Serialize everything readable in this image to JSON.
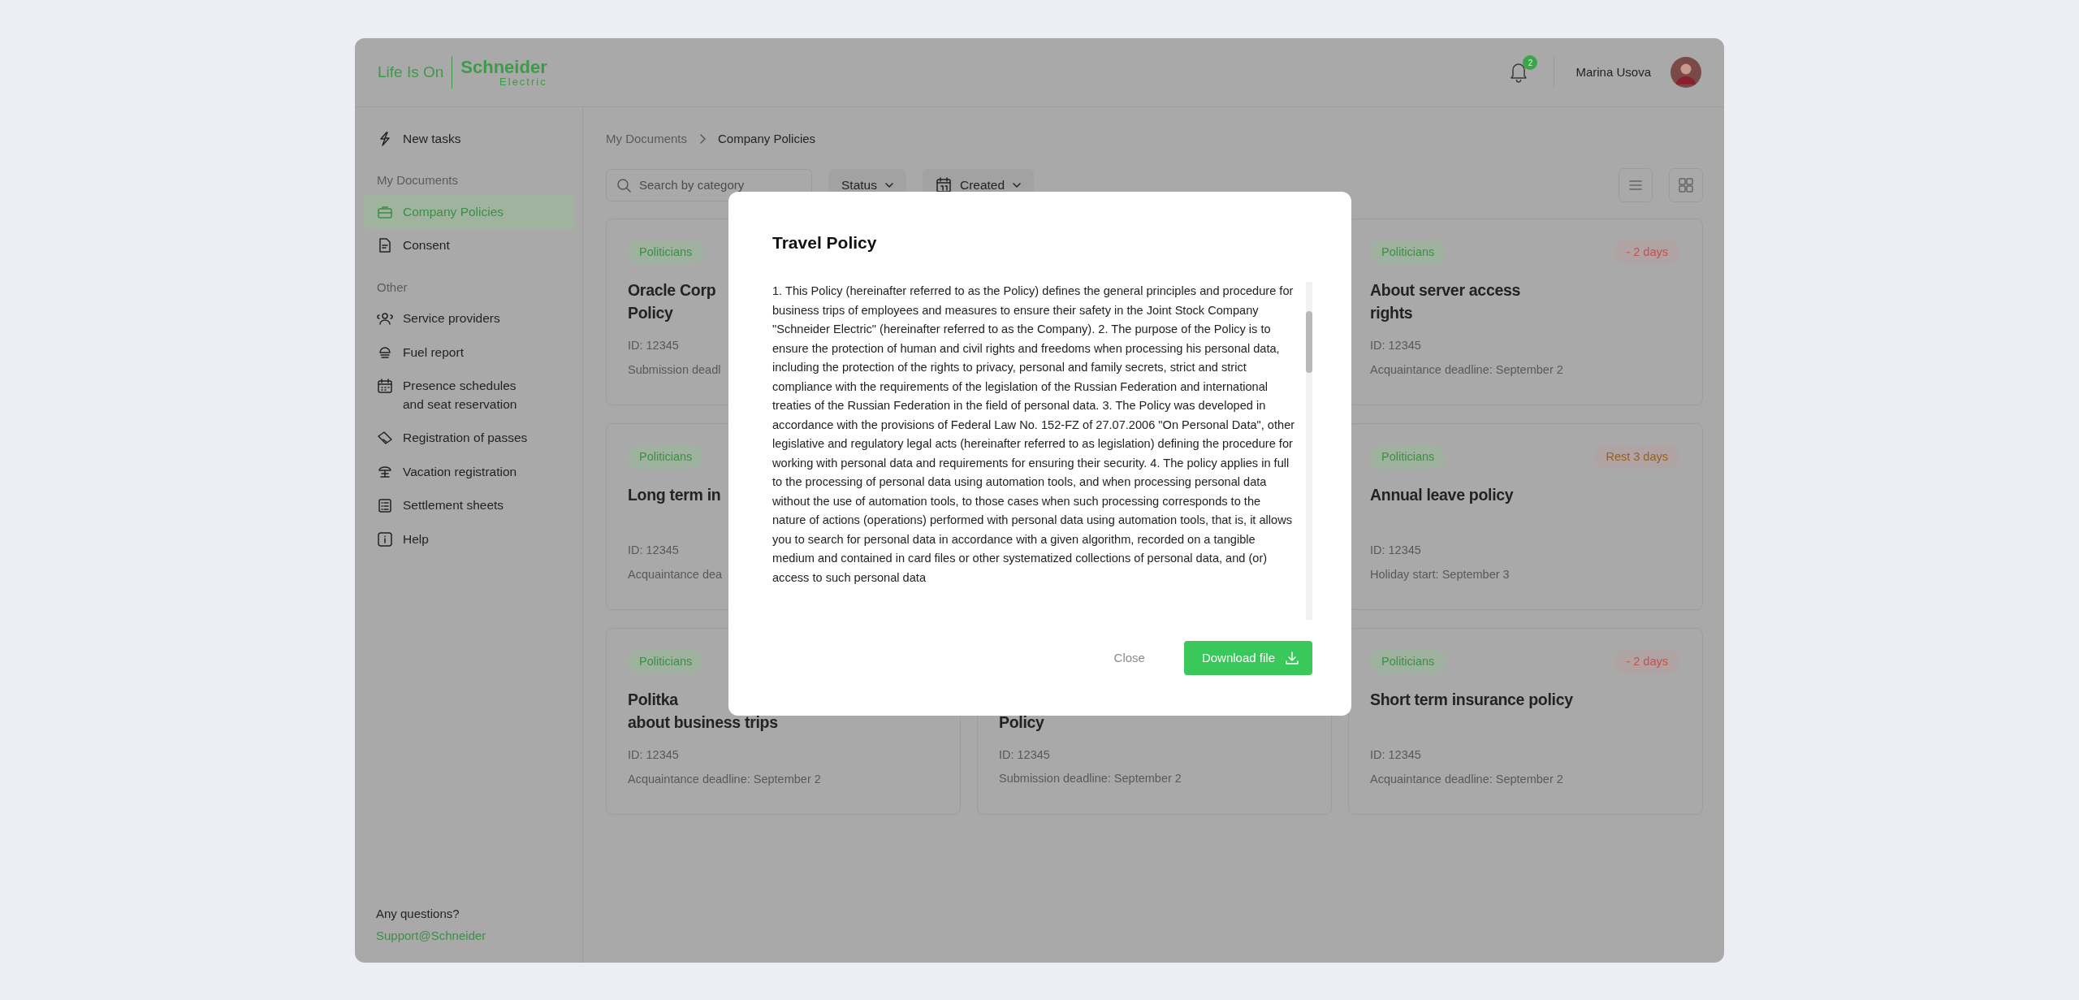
{
  "header": {
    "logo": {
      "tagline": "Life Is On",
      "brand": "Schneider",
      "sub": "Electric"
    },
    "notifications": {
      "count": "2"
    },
    "user": {
      "name": "Marina Usova"
    }
  },
  "sidebar": {
    "items": [
      {
        "kind": "item",
        "label": "New tasks",
        "selected": false
      },
      {
        "kind": "heading",
        "label": "My Documents"
      },
      {
        "kind": "item",
        "label": "Company Policies",
        "selected": true
      },
      {
        "kind": "item",
        "label": "Consent",
        "selected": false
      },
      {
        "kind": "heading",
        "label": "Other"
      },
      {
        "kind": "item",
        "label": "Service providers",
        "selected": false
      },
      {
        "kind": "item",
        "label": "Fuel report",
        "selected": false
      },
      {
        "kind": "item",
        "label": "Presence schedules\n and seat reservation",
        "selected": false
      },
      {
        "kind": "item",
        "label": "Registration of passes",
        "selected": false
      },
      {
        "kind": "item",
        "label": "Vacation registration",
        "selected": false
      },
      {
        "kind": "item",
        "label": "Settlement sheets",
        "selected": false
      },
      {
        "kind": "item",
        "label": "Help",
        "selected": false
      }
    ],
    "footer": {
      "question": "Any questions?",
      "link": "Support@Schneider"
    }
  },
  "breadcrumb": [
    {
      "label": "My Documents",
      "selected": false
    },
    {
      "label": "Company Policies",
      "selected": true
    }
  ],
  "filters": {
    "search": {
      "placeholder": "Search by category"
    },
    "dropdowns": [
      {
        "label": "Status"
      },
      {
        "label": "Created"
      }
    ]
  },
  "cards": [
    {
      "kind": "card",
      "badge": "Politicians",
      "title_lines": [
        "Oracle Corp",
        "Policy"
      ],
      "id": "ID: 12345",
      "deadline": "Submission deadl"
    },
    {
      "kind": "card",
      "badge": "Politicians",
      "status": {
        "text": "- 2 days",
        "color": "#c9504c"
      },
      "title_lines": [
        "About server access",
        "rights"
      ],
      "id": "ID: 12345",
      "deadline": "Acquaintance deadline: September 2"
    },
    {
      "kind": "card",
      "badge": "Politicians",
      "title_lines": [
        "Long term in"
      ],
      "id": "ID: 12345",
      "deadline": "Acquaintance dea"
    },
    {
      "kind": "card",
      "badge": "Politicians",
      "status": {
        "text": "Rest 3 days",
        "color": "#985f1c"
      },
      "title_lines": [
        "Annual leave policy"
      ],
      "id": "ID: 12345",
      "deadline": "Holiday start: September 3"
    },
    {
      "kind": "card",
      "badge": "Politicians",
      "title_lines": [
        "Politka",
        "about business trips"
      ],
      "id": "ID: 12345",
      "deadline": "Acquaintance deadline: September 2"
    },
    {
      "kind": "card_top_covered",
      "title_lines": [
        "Policy"
      ],
      "id": "ID: 12345",
      "deadline": "Submission deadline: September 2"
    },
    {
      "kind": "card",
      "badge": "Politicians",
      "status": {
        "text": "- 2 days",
        "color": "#c9504c"
      },
      "title_lines": [
        "Short term insurance policy"
      ],
      "id": "ID: 12345",
      "deadline": "Acquaintance deadline: September 2"
    }
  ],
  "modal": {
    "title": "Travel Policy",
    "body": "1. This Policy (hereinafter referred to as the Policy) defines the general principles and procedure for business trips of employees and measures to ensure their safety in the Joint Stock Company \"Schneider Electric\" (hereinafter referred to as the Company). 2. The purpose of the Policy is to ensure the protection of human and civil rights and freedoms when processing his personal data, including the protection of the rights to privacy, personal and family secrets, strict and strict compliance with the requirements of the legislation of the Russian Federation and international treaties of the Russian Federation in the field of personal data. 3. The Policy was developed in accordance with the provisions of Federal Law No. 152-FZ of 27.07.2006 \"On Personal Data\", other legislative and regulatory legal acts (hereinafter referred to as legislation) defining the procedure for working with personal data and requirements for ensuring their security. 4. The policy applies in full to the processing of personal data using automation tools, and when processing personal data without the use of automation tools, to those cases when such processing corresponds to the nature of actions (operations) performed with personal data using automation tools, that is, it allows you to search for personal data in accordance with a given algorithm, recorded on a tangible medium and contained in card files or other systematized collections of personal data, and (or) access to such personal data",
    "buttons": [
      {
        "kind": "secondary",
        "label": "Close"
      },
      {
        "kind": "primary",
        "label": "Download file"
      }
    ]
  }
}
